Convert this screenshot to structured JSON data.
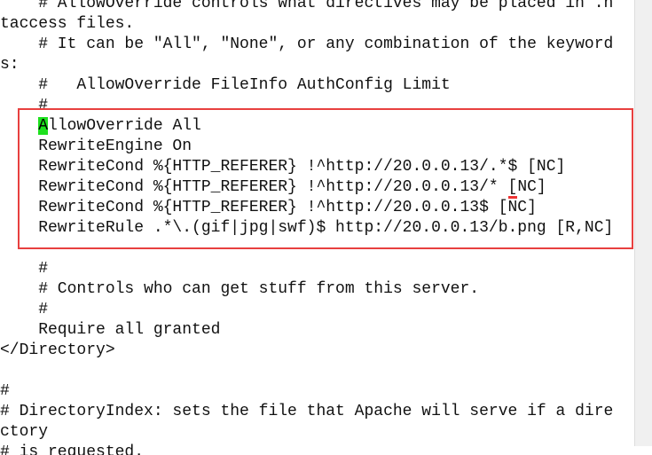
{
  "editor": {
    "lines": [
      "    # AllowOverride controls what directives may be placed in .h",
      "taccess files.",
      "    # It can be \"All\", \"None\", or any combination of the keyword",
      "s:",
      "    #   AllowOverride FileInfo AuthConfig Limit",
      "    #",
      "    AllowOverride All",
      "    RewriteEngine On",
      "    RewriteCond %{HTTP_REFERER} !^http://20.0.0.13/.*$ [NC]",
      "    RewriteCond %{HTTP_REFERER} !^http://20.0.0.13/* [NC]",
      "    RewriteCond %{HTTP_REFERER} !^http://20.0.0.13$ [NC]",
      "    RewriteRule .*\\.(gif|jpg|swf)$ http://20.0.0.13/b.png [R,NC]",
      "",
      "    #",
      "    # Controls who can get stuff from this server.",
      "    #",
      "    Require all granted",
      "</Directory>",
      "",
      "#",
      "# DirectoryIndex: sets the file that Apache will serve if a dire",
      "ctory",
      "# is requested."
    ],
    "cursor_line_prefix": "    ",
    "cursor_char": "A",
    "cursor_line_rest": "llowOverride All",
    "mark_line_prefix": "    RewriteCond %{HTTP_REFERER} !^http://20.0.0.13/* ",
    "mark_char": "[",
    "mark_line_rest": "NC]",
    "cursor_color": "#1ee01e",
    "highlight_color": "#e8403f"
  }
}
